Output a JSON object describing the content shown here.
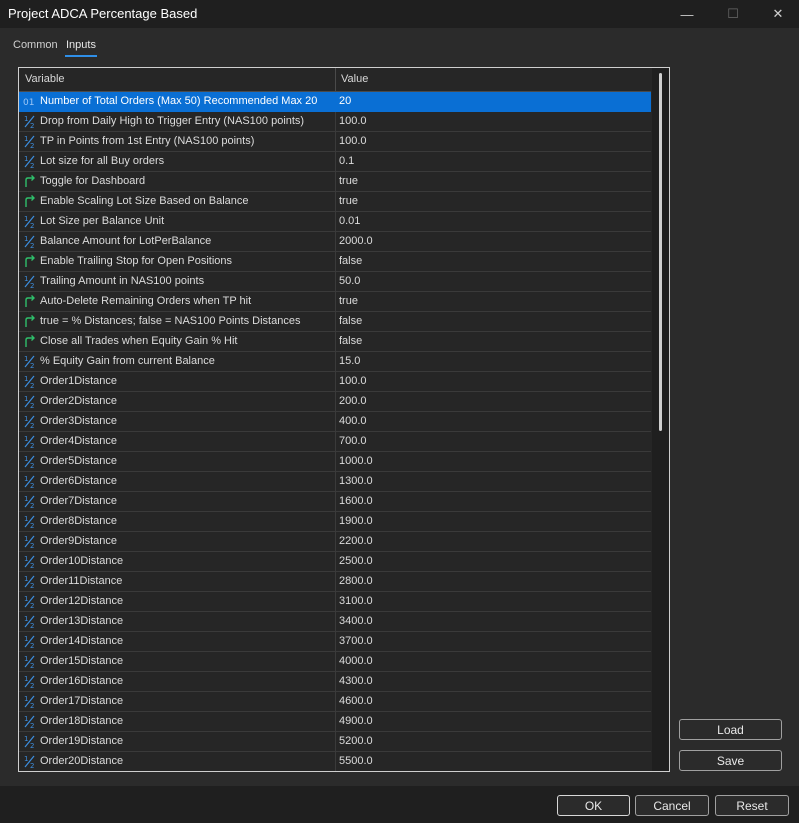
{
  "window": {
    "title": "Project ADCA Percentage Based",
    "minimize_glyph": "—",
    "maximize_glyph": "☐",
    "close_glyph": "✕"
  },
  "tabs": [
    {
      "label": "Common"
    },
    {
      "label": "Inputs",
      "active": true
    }
  ],
  "grid": {
    "columns": [
      "Variable",
      "Value"
    ],
    "rows": [
      {
        "icon": "integer-icon",
        "name": "Number of Total Orders (Max 50) Recommended Max 20",
        "value": "20",
        "selected": true
      },
      {
        "icon": "fraction-icon",
        "name": "Drop from Daily High to Trigger Entry (NAS100 points)",
        "value": "100.0"
      },
      {
        "icon": "fraction-icon",
        "name": "TP in Points from 1st Entry (NAS100 points)",
        "value": "100.0"
      },
      {
        "icon": "fraction-icon",
        "name": "Lot size for all Buy orders",
        "value": "0.1"
      },
      {
        "icon": "bool-arrow-icon",
        "name": "Toggle for Dashboard",
        "value": "true"
      },
      {
        "icon": "bool-arrow-icon",
        "name": "Enable Scaling Lot Size Based on Balance",
        "value": "true"
      },
      {
        "icon": "fraction-icon",
        "name": "Lot Size per Balance Unit",
        "value": "0.01"
      },
      {
        "icon": "fraction-icon",
        "name": "Balance Amount for LotPerBalance",
        "value": "2000.0"
      },
      {
        "icon": "bool-arrow-icon",
        "name": "Enable Trailing Stop for Open Positions",
        "value": "false"
      },
      {
        "icon": "fraction-icon",
        "name": "Trailing Amount in NAS100 points",
        "value": "50.0"
      },
      {
        "icon": "bool-arrow-icon",
        "name": "Auto-Delete Remaining Orders when TP hit",
        "value": "true"
      },
      {
        "icon": "bool-arrow-icon",
        "name": "true = % Distances; false = NAS100 Points Distances",
        "value": "false"
      },
      {
        "icon": "bool-arrow-icon",
        "name": "Close all Trades when Equity Gain % Hit",
        "value": "false"
      },
      {
        "icon": "fraction-icon",
        "name": "% Equity Gain from current Balance",
        "value": "15.0"
      },
      {
        "icon": "fraction-icon",
        "name": "Order1Distance",
        "value": "100.0"
      },
      {
        "icon": "fraction-icon",
        "name": "Order2Distance",
        "value": "200.0"
      },
      {
        "icon": "fraction-icon",
        "name": "Order3Distance",
        "value": "400.0"
      },
      {
        "icon": "fraction-icon",
        "name": "Order4Distance",
        "value": "700.0"
      },
      {
        "icon": "fraction-icon",
        "name": "Order5Distance",
        "value": "1000.0"
      },
      {
        "icon": "fraction-icon",
        "name": "Order6Distance",
        "value": "1300.0"
      },
      {
        "icon": "fraction-icon",
        "name": "Order7Distance",
        "value": "1600.0"
      },
      {
        "icon": "fraction-icon",
        "name": "Order8Distance",
        "value": "1900.0"
      },
      {
        "icon": "fraction-icon",
        "name": "Order9Distance",
        "value": "2200.0"
      },
      {
        "icon": "fraction-icon",
        "name": "Order10Distance",
        "value": "2500.0"
      },
      {
        "icon": "fraction-icon",
        "name": "Order11Distance",
        "value": "2800.0"
      },
      {
        "icon": "fraction-icon",
        "name": "Order12Distance",
        "value": "3100.0"
      },
      {
        "icon": "fraction-icon",
        "name": "Order13Distance",
        "value": "3400.0"
      },
      {
        "icon": "fraction-icon",
        "name": "Order14Distance",
        "value": "3700.0"
      },
      {
        "icon": "fraction-icon",
        "name": "Order15Distance",
        "value": "4000.0"
      },
      {
        "icon": "fraction-icon",
        "name": "Order16Distance",
        "value": "4300.0"
      },
      {
        "icon": "fraction-icon",
        "name": "Order17Distance",
        "value": "4600.0"
      },
      {
        "icon": "fraction-icon",
        "name": "Order18Distance",
        "value": "4900.0"
      },
      {
        "icon": "fraction-icon",
        "name": "Order19Distance",
        "value": "5200.0"
      },
      {
        "icon": "fraction-icon",
        "name": "Order20Distance",
        "value": "5500.0"
      }
    ]
  },
  "side_buttons": {
    "load": "Load",
    "save": "Save"
  },
  "footer_buttons": {
    "ok": "OK",
    "cancel": "Cancel",
    "reset": "Reset"
  },
  "colors": {
    "selection": "#0a6fd4",
    "fraction_icon": "#3d8fe0",
    "bool_icon": "#2fbf6b",
    "integer_icon": "#2a66c8"
  }
}
